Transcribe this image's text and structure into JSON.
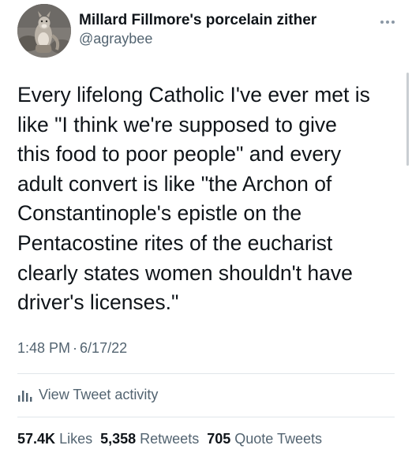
{
  "author": {
    "display_name": "Millard Fillmore's porcelain zither",
    "handle": "@agraybee",
    "avatar_icon": "profile-photo"
  },
  "more_icon": "more-options-icon",
  "tweet": {
    "text": "Every lifelong Catholic I've ever met is\nlike \"I think we're supposed to give\nthis food to poor people\" and every\nadult convert is like \"the Archon of\nConstantinople's epistle on the\nPentacostine rites of the eucharist\nclearly states women shouldn't have\ndriver's licenses.\""
  },
  "meta": {
    "time": "1:48 PM",
    "separator": "·",
    "date": "6/17/22"
  },
  "activity": {
    "label": "View Tweet activity",
    "icon": "analytics-icon"
  },
  "stats": {
    "likes_count": "57.4K",
    "likes_label": "Likes",
    "retweets_count": "5,358",
    "retweets_label": "Retweets",
    "quotes_count": "705",
    "quotes_label": "Quote Tweets"
  },
  "colors": {
    "text_primary": "#0f1419",
    "text_secondary": "#536471",
    "divider": "#e1e6ea"
  }
}
